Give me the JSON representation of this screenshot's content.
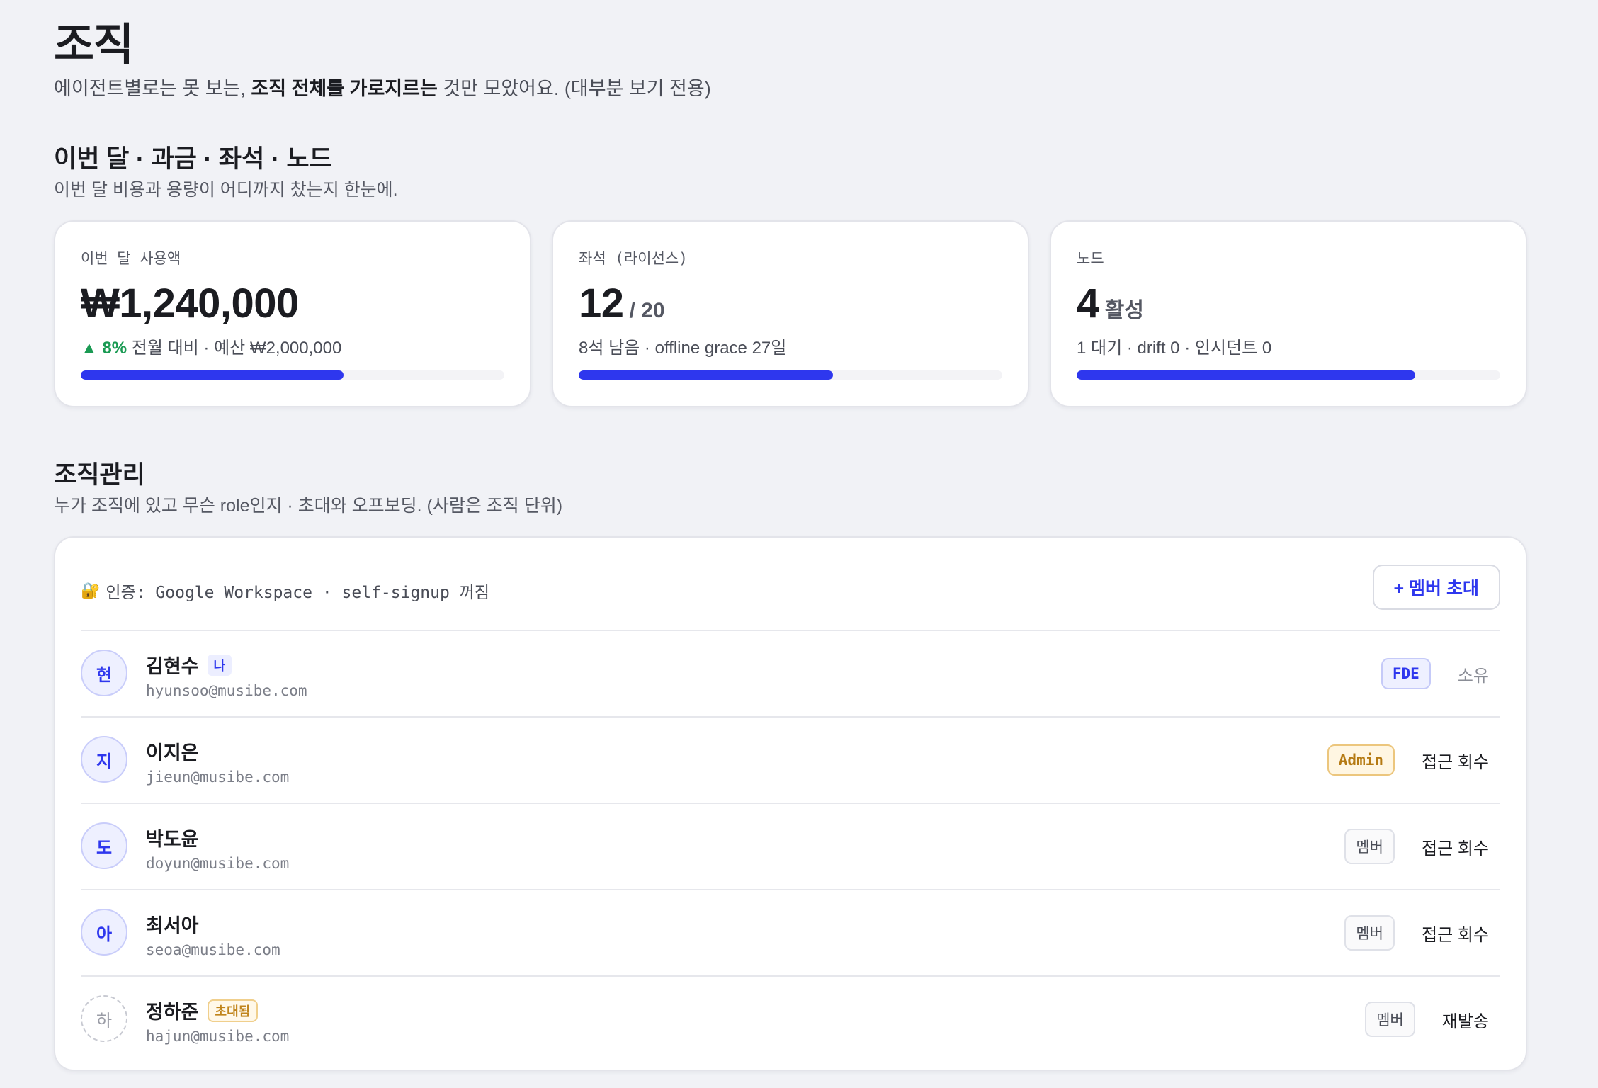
{
  "page": {
    "title": "조직",
    "subtitle_pre": "에이전트별로는 못 보는, ",
    "subtitle_bold": "조직 전체를 가로지르는",
    "subtitle_post": " 것만 모았어요. (대부분 보기 전용)"
  },
  "usage_section": {
    "title": "이번 달 · 과금 · 좌석 · 노드",
    "description": "이번 달 비용과 용량이 어디까지 찼는지 한눈에."
  },
  "stats": [
    {
      "label": "이번 달 사용액",
      "value": "₩1,240,000",
      "suffix": "",
      "trend": "▲ 8%",
      "sub": " 전월 대비 · 예산 ₩2,000,000",
      "progress": 0.62
    },
    {
      "label": "좌석 (라이선스)",
      "value": "12",
      "suffix": "/ 20",
      "trend": "",
      "sub": "8석 남음 · offline grace 27일",
      "progress": 0.6
    },
    {
      "label": "노드",
      "value": "4",
      "suffix": "활성",
      "trend": "",
      "sub": "1 대기 · drift 0 · 인시던트 0",
      "progress": 0.8
    }
  ],
  "org_section": {
    "title": "조직관리",
    "description": "누가 조직에 있고 무슨 role인지 · 초대와 오프보딩. (사람은 조직 단위)"
  },
  "members_card": {
    "auth_icon": "🔐",
    "auth_text": "인증: Google Workspace · self-signup 꺼짐",
    "invite_label": "+ 멤버 초대"
  },
  "members": [
    {
      "initial": "현",
      "name": "김현수",
      "me_badge": "나",
      "invited_badge": "",
      "email": "hyunsoo@musibe.com",
      "role": "FDE",
      "role_type": "fde",
      "action": "소유",
      "pending": false
    },
    {
      "initial": "지",
      "name": "이지은",
      "me_badge": "",
      "invited_badge": "",
      "email": "jieun@musibe.com",
      "role": "Admin",
      "role_type": "admin",
      "action": "접근 회수",
      "pending": false
    },
    {
      "initial": "도",
      "name": "박도윤",
      "me_badge": "",
      "invited_badge": "",
      "email": "doyun@musibe.com",
      "role": "멤버",
      "role_type": "member",
      "action": "접근 회수",
      "pending": false
    },
    {
      "initial": "아",
      "name": "최서아",
      "me_badge": "",
      "invited_badge": "",
      "email": "seoa@musibe.com",
      "role": "멤버",
      "role_type": "member",
      "action": "접근 회수",
      "pending": false
    },
    {
      "initial": "하",
      "name": "정하준",
      "me_badge": "",
      "invited_badge": "초대됨",
      "email": "hajun@musibe.com",
      "role": "멤버",
      "role_type": "member",
      "action": "재발송",
      "pending": true
    }
  ],
  "colors": {
    "accent": "#2e37ee",
    "trend_up": "#1a9a53",
    "admin": "#b57a12",
    "background": "#f1f2f6"
  }
}
